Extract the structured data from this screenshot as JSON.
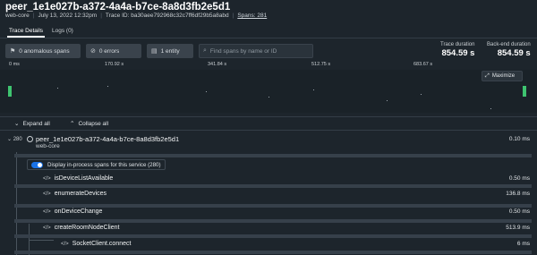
{
  "header": {
    "title": "peer_1e1e027b-a372-4a4a-b7ce-8a8d3fb2e5d1",
    "service": "web-core",
    "date": "July 13, 2022 12:32pm",
    "trace_id": "Trace ID: ba30aee792968c32c7ff6df29b5a8abd",
    "spans_label": "Spans: 281"
  },
  "tabs": [
    {
      "label": "Trace Details",
      "active": true
    },
    {
      "label": "Logs (0)",
      "active": false
    }
  ],
  "filters": {
    "anomalous": "0 anomalous spans",
    "errors": "0 errors",
    "entity": "1 entity",
    "search_placeholder": "Find spans by name or ID"
  },
  "durations": {
    "trace_label": "Trace duration",
    "trace_value": "854.59 s",
    "backend_label": "Back-end duration",
    "backend_value": "854.59 s"
  },
  "ruler": [
    "0 ms",
    "170.92 s",
    "341.84 s",
    "512.75 s",
    "683.67 s"
  ],
  "minimap": {
    "maximize_label": "Maximize",
    "accent": "#3ec470"
  },
  "actions": {
    "expand_all": "Expand all",
    "collapse_all": "Collapse all"
  },
  "root": {
    "count": "280",
    "name": "peer_1e1e027b-a372-4a4a-b7ce-8a8d3fb2e5d1",
    "service": "web-core",
    "duration": "0.10 ms"
  },
  "in_process": {
    "label": "Display in-process spans for this service (280)",
    "enabled": true
  },
  "spans": [
    {
      "name": "isDeviceListAvailable",
      "duration": "0.50 ms"
    },
    {
      "name": "enumerateDevices",
      "duration": "136.8 ms"
    },
    {
      "name": "onDeviceChange",
      "duration": "0.50 ms"
    },
    {
      "name": "createRoomNodeClient",
      "duration": "513.9 ms"
    },
    {
      "name": "SocketClient.connect",
      "duration": "6 ms"
    }
  ]
}
